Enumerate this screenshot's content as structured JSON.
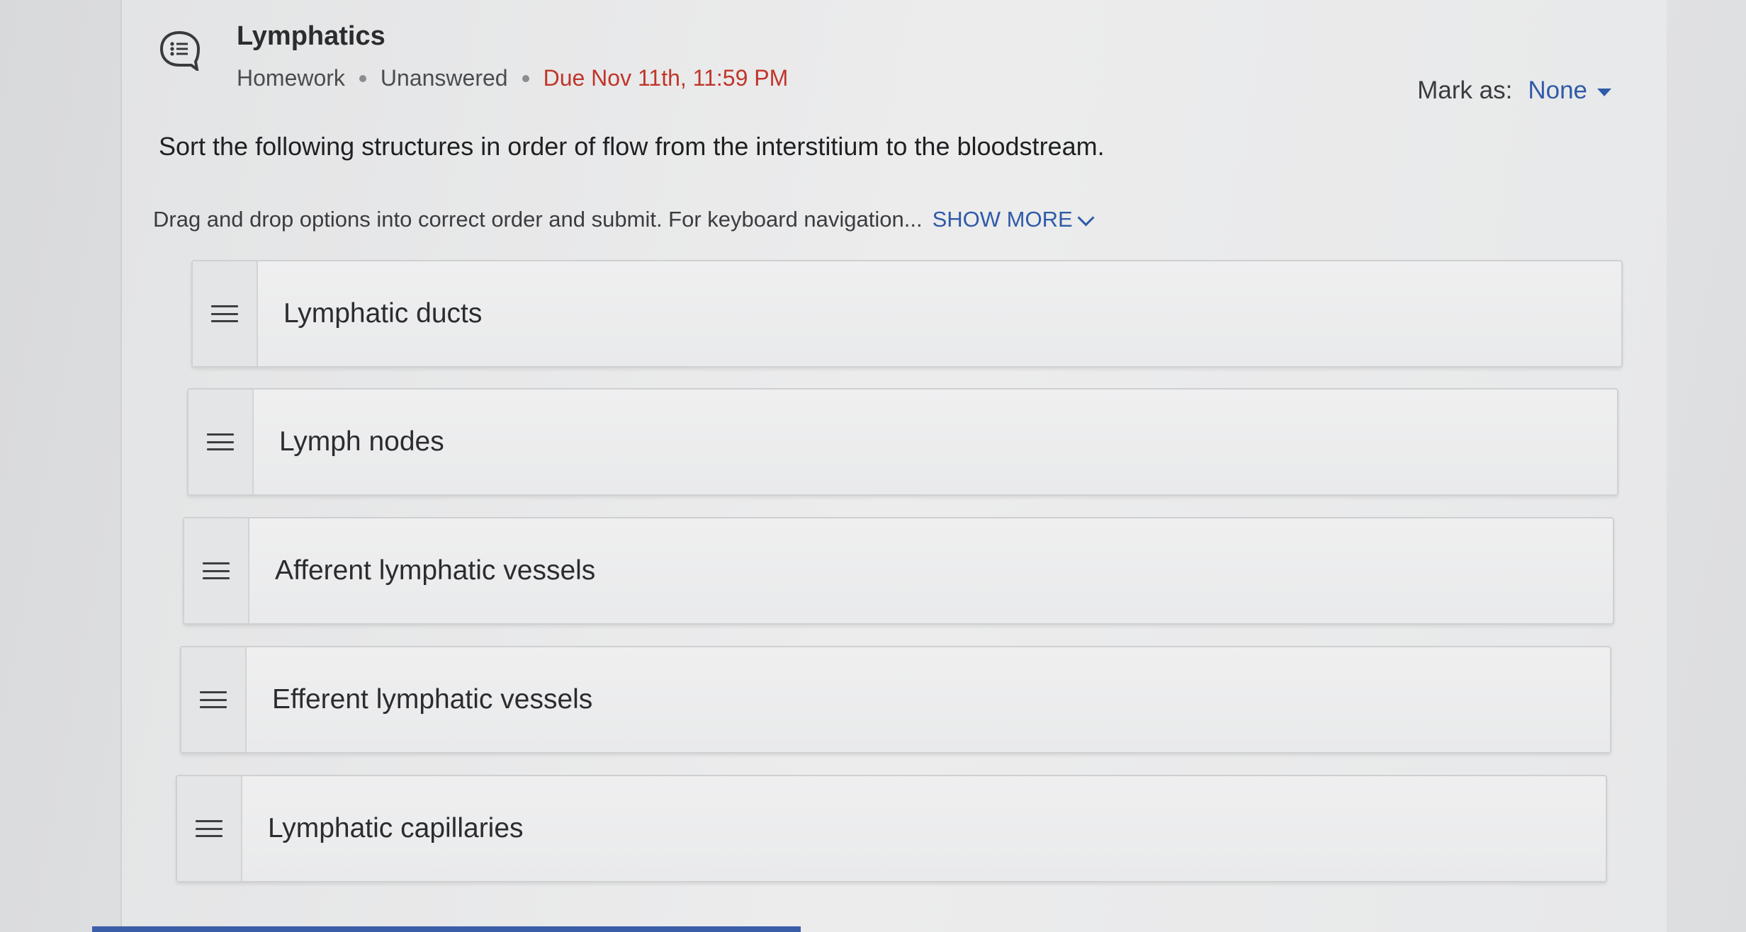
{
  "header": {
    "icon": "list-bubble-icon",
    "title": "Lymphatics",
    "type": "Homework",
    "status": "Unanswered",
    "due": "Due Nov 11th, 11:59 PM",
    "mark_as_label": "Mark as:",
    "mark_as_value": "None"
  },
  "question": {
    "prompt": "Sort the following structures in order of flow from the interstitium to the bloodstream.",
    "instructions": "Drag and drop options into correct order and submit. For keyboard navigation...",
    "show_more": "SHOW MORE"
  },
  "items": [
    {
      "label": "Lymphatic ducts"
    },
    {
      "label": "Lymph nodes"
    },
    {
      "label": "Afferent lymphatic vessels"
    },
    {
      "label": "Efferent lymphatic vessels"
    },
    {
      "label": "Lymphatic capillaries"
    }
  ],
  "colors": {
    "accent": "#2f5aa8",
    "due": "#c0352b"
  }
}
